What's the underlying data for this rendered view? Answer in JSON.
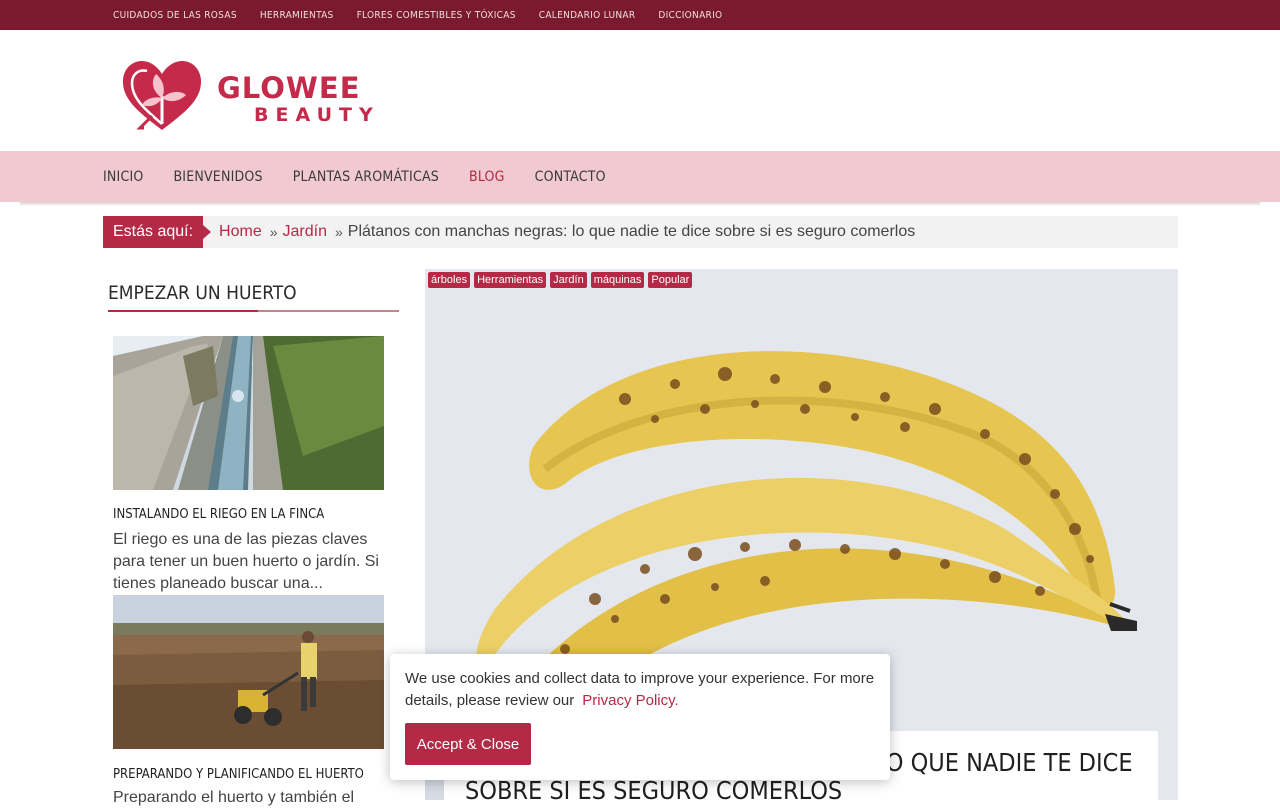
{
  "topbar": {
    "items": [
      "CUIDADOS DE LAS ROSAS",
      "HERRAMIENTAS",
      "FLORES COMESTIBLES Y TÓXICAS",
      "CALENDARIO LUNAR",
      "DICCIONARIO"
    ]
  },
  "logo": {
    "line1": "GLOWEE",
    "line2": "BEAUTY"
  },
  "mainnav": {
    "items": [
      "INICIO",
      "BIENVENIDOS",
      "PLANTAS AROMÁTICAS",
      "BLOG",
      "CONTACTO"
    ],
    "active": "BLOG"
  },
  "breadcrumb": {
    "label": "Estás aquí:",
    "home": "Home",
    "section": "Jardín",
    "current": "Plátanos con manchas negras: lo que nadie te dice sobre si es seguro comerlos"
  },
  "sidebar": {
    "title": "EMPEZAR UN HUERTO",
    "posts": [
      {
        "title": "INSTALANDO EL RIEGO EN LA FINCA",
        "excerpt": "El riego es una de las piezas claves para tener un buen huerto o jardín. Si tienes planeado buscar una..."
      },
      {
        "title": "PREPARANDO Y PLANIFICANDO EL HUERTO",
        "excerpt": "Preparando el huerto y también el"
      }
    ]
  },
  "article": {
    "tags": [
      "árboles",
      "Herramientas",
      "Jardín",
      "máquinas",
      "Popular"
    ],
    "title": "Plátanos con manchas negras: lo que nadie te dice sobre si es seguro comerlos"
  },
  "cookie": {
    "text": "We use cookies and collect data to improve your experience. For more details, please review our",
    "link": "Privacy Policy.",
    "button": "Accept & Close"
  },
  "colors": {
    "brand": "#b42a46",
    "topbar": "#7a1a2c",
    "nav_bg": "#f0c9d1"
  }
}
